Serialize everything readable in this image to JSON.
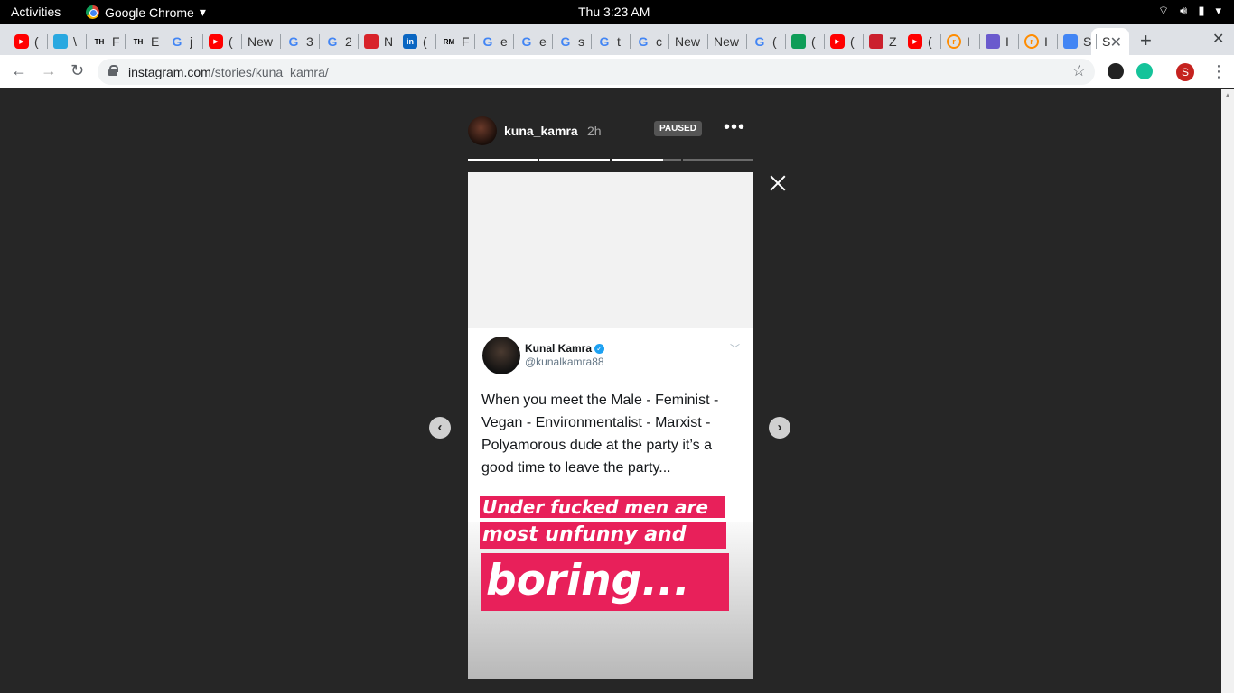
{
  "system": {
    "activities": "Activities",
    "app_name": "Google Chrome",
    "clock": "Thu  3:23 AM"
  },
  "tabs": [
    {
      "label": "(",
      "icon": "youtube-icon",
      "color": "#ff0000"
    },
    {
      "label": "\\",
      "icon": "app-icon",
      "color": "#29a8e0"
    },
    {
      "label": "F",
      "icon": "th-icon",
      "color": "#ffffff"
    },
    {
      "label": "E",
      "icon": "th-icon",
      "color": "#ffffff"
    },
    {
      "label": "j",
      "icon": "google-icon",
      "color": "#4285f4"
    },
    {
      "label": "(",
      "icon": "youtube-icon",
      "color": "#ff0000"
    },
    {
      "label": "New",
      "icon": "none",
      "color": ""
    },
    {
      "label": "3",
      "icon": "google-icon",
      "color": "#4285f4"
    },
    {
      "label": "2",
      "icon": "google-icon",
      "color": "#4285f4"
    },
    {
      "label": "N",
      "icon": "news-icon",
      "color": "#d8232a"
    },
    {
      "label": "(",
      "icon": "linkedin-icon",
      "color": "#0a66c2"
    },
    {
      "label": "F",
      "icon": "rm-icon",
      "color": "#ffffff"
    },
    {
      "label": "e",
      "icon": "google-icon",
      "color": "#4285f4"
    },
    {
      "label": "e",
      "icon": "google-icon",
      "color": "#4285f4"
    },
    {
      "label": "s",
      "icon": "google-icon",
      "color": "#4285f4"
    },
    {
      "label": "t",
      "icon": "google-icon",
      "color": "#4285f4"
    },
    {
      "label": "c",
      "icon": "google-icon",
      "color": "#4285f4"
    },
    {
      "label": "New",
      "icon": "none",
      "color": ""
    },
    {
      "label": "New",
      "icon": "none",
      "color": ""
    },
    {
      "label": "(",
      "icon": "google-icon",
      "color": "#4285f4"
    },
    {
      "label": "(",
      "icon": "sheets-icon",
      "color": "#0f9d58"
    },
    {
      "label": "(",
      "icon": "youtube-icon",
      "color": "#ff0000"
    },
    {
      "label": "Z",
      "icon": "zomato-icon",
      "color": "#cb202d"
    },
    {
      "label": "(",
      "icon": "youtube-icon",
      "color": "#ff0000"
    },
    {
      "label": "I",
      "icon": "r-icon",
      "color": "#ff8c00"
    },
    {
      "label": "I",
      "icon": "cube-icon",
      "color": "#6a5acd"
    },
    {
      "label": "I",
      "icon": "r-icon",
      "color": "#ff8c00"
    },
    {
      "label": "S",
      "icon": "abc-icon",
      "color": "#4285f4"
    }
  ],
  "active_tab": {
    "label": "S"
  },
  "address": {
    "domain": "instagram.com",
    "path": "/stories/kuna_kamra/"
  },
  "profile_initial": "S",
  "story": {
    "username": "kuna_kamra",
    "time": "2h",
    "paused_label": "PAUSED",
    "progress": [
      1,
      1,
      0.75,
      0
    ],
    "tweet": {
      "name": "Kunal Kamra",
      "handle": "@kunalkamra88",
      "text": "When you meet the Male - Feminist - Vegan - Environmentalist - Marxist - Polyamorous dude at the party it’s a good time to leave the party..."
    },
    "sticker": {
      "line1": "Under fucked men are",
      "line2": "most unfunny and",
      "line3": "boring..."
    }
  }
}
